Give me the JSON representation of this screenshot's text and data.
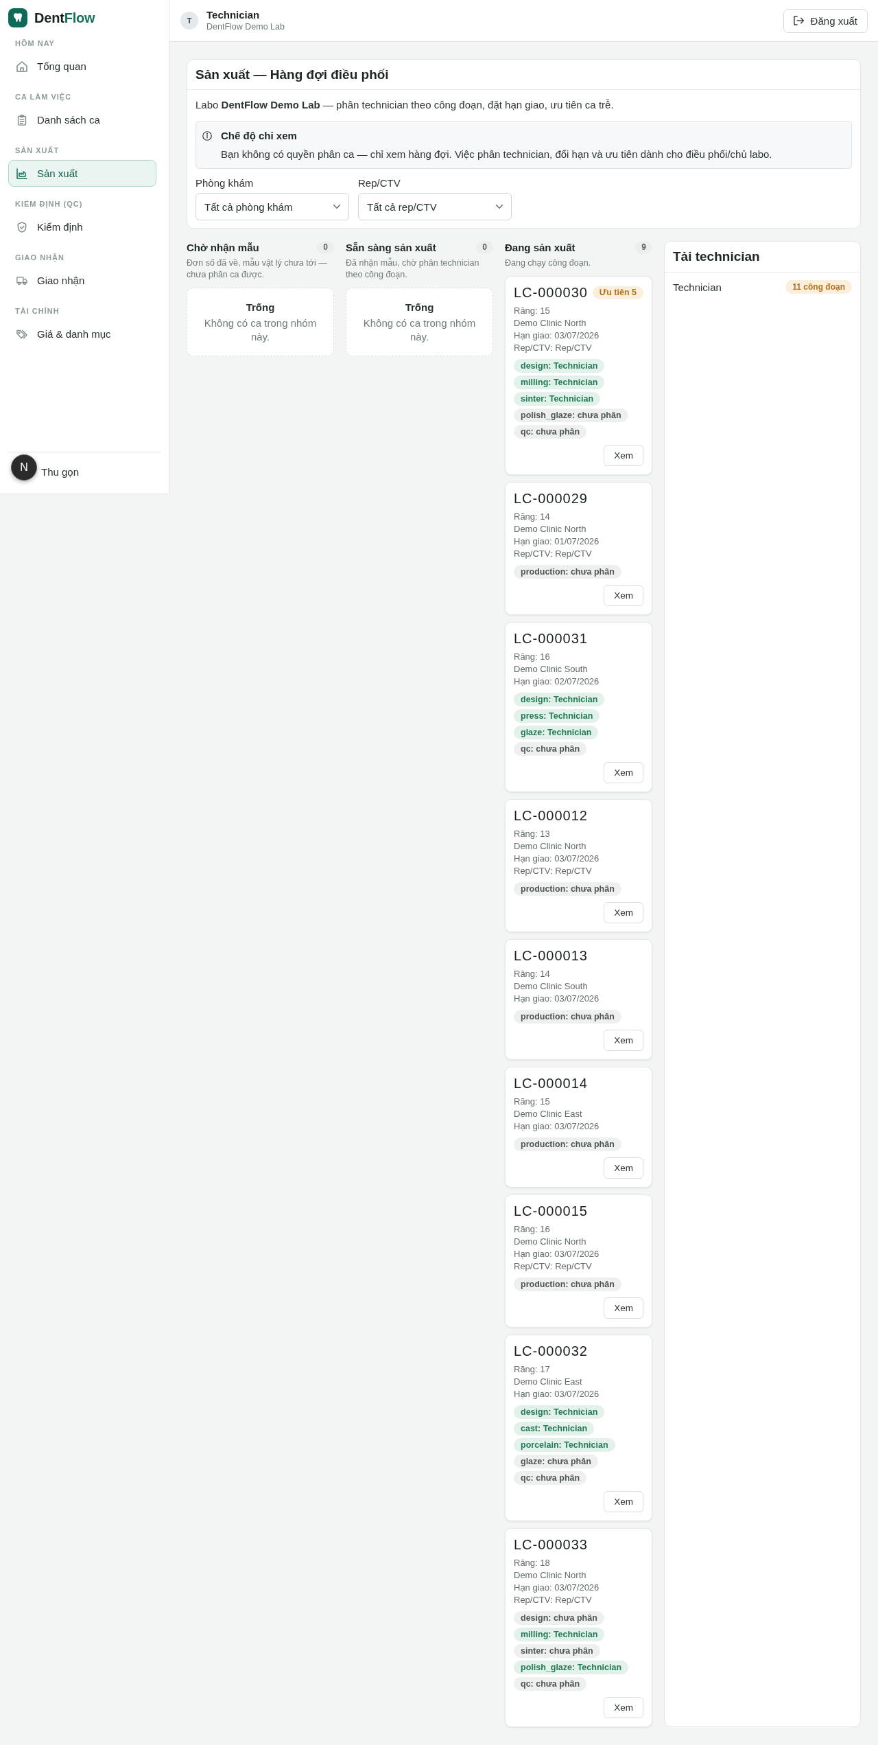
{
  "sidebar": {
    "brand": {
      "lead": "Dent",
      "accent": "Flow"
    },
    "sections": [
      {
        "heading": "HÔM NAY",
        "items": [
          {
            "label": "Tổng quan",
            "selected": false
          }
        ]
      },
      {
        "heading": "CA LÀM VIỆC",
        "items": [
          {
            "label": "Danh sách ca",
            "selected": false
          }
        ]
      },
      {
        "heading": "SẢN XUẤT",
        "items": [
          {
            "label": "Sản xuất",
            "selected": true
          }
        ]
      },
      {
        "heading": "KIỂM ĐỊNH (QC)",
        "items": [
          {
            "label": "Kiểm định",
            "selected": false
          }
        ]
      },
      {
        "heading": "GIAO NHẬN",
        "items": [
          {
            "label": "Giao nhận",
            "selected": false
          }
        ]
      },
      {
        "heading": "TÀI CHÍNH",
        "items": [
          {
            "label": "Giá & danh mục",
            "selected": false
          }
        ]
      }
    ],
    "collapse_label": "Thu gọn"
  },
  "dev_tools_badge": "N",
  "header": {
    "avatar": "T",
    "user_name": "Technician",
    "lab_name": "DentFlow Demo Lab",
    "logout_label": "Đăng xuất"
  },
  "queue_panel": {
    "title": "Sản xuất — Hàng đợi điều phối",
    "description": "Labo **DentFlow Demo Lab** — phân technician theo công đoạn, đặt hạn giao, ưu tiên ca trễ.",
    "notice": {
      "title": "Chế độ chỉ xem",
      "text": "Bạn không có quyền phân ca — chỉ xem hàng đợi. Việc phân technician, đổi hạn và ưu tiên dành cho điều phối/chủ labo."
    },
    "filters": [
      {
        "label": "Phòng khám",
        "value": "Tất cả phòng khám"
      },
      {
        "label": "Rep/CTV",
        "value": "Tất cả rep/CTV"
      }
    ]
  },
  "columns": [
    {
      "title": "Chờ nhận mẫu",
      "count": "0",
      "description": "Đơn số đã về, mẫu vật lý chưa tới — chưa phân ca được.",
      "empty_state": {
        "title": "Trống",
        "text": "Không có ca trong nhóm này."
      }
    },
    {
      "title": "Sẵn sàng sản xuất",
      "count": "0",
      "description": "Đã nhận mẫu, chờ phân technician theo công đoạn.",
      "empty_state": {
        "title": "Trống",
        "text": "Không có ca trong nhóm này."
      }
    },
    {
      "title": "Đang sản xuất",
      "count": "9",
      "description": "Đang chạy công đoạn.",
      "cards": [
        {
          "case_id": "LC-000030",
          "priority": "Ưu tiên 5",
          "teeth": "Răng: 15",
          "clinic": "Demo Clinic North",
          "due": "Hạn giao: 03/07/2026",
          "rep": "Rep/CTV: Rep/CTV",
          "tags": [
            {
              "label": "design: Technician",
              "assigned": true
            },
            {
              "label": "milling: Technician",
              "assigned": true
            },
            {
              "label": "sinter: Technician",
              "assigned": true
            },
            {
              "label": "polish_glaze: chưa phân",
              "assigned": false
            },
            {
              "label": "qc: chưa phân",
              "assigned": false
            }
          ],
          "view_label": "Xem"
        },
        {
          "case_id": "LC-000029",
          "teeth": "Răng: 14",
          "clinic": "Demo Clinic North",
          "due": "Hạn giao: 01/07/2026",
          "rep": "Rep/CTV: Rep/CTV",
          "tags": [
            {
              "label": "production: chưa phân",
              "assigned": false
            }
          ],
          "view_label": "Xem"
        },
        {
          "case_id": "LC-000031",
          "teeth": "Răng: 16",
          "clinic": "Demo Clinic South",
          "due": "Hạn giao: 02/07/2026",
          "tags": [
            {
              "label": "design: Technician",
              "assigned": true
            },
            {
              "label": "press: Technician",
              "assigned": true
            },
            {
              "label": "glaze: Technician",
              "assigned": true
            },
            {
              "label": "qc: chưa phân",
              "assigned": false
            }
          ],
          "view_label": "Xem"
        },
        {
          "case_id": "LC-000012",
          "teeth": "Răng: 13",
          "clinic": "Demo Clinic North",
          "due": "Hạn giao: 03/07/2026",
          "rep": "Rep/CTV: Rep/CTV",
          "tags": [
            {
              "label": "production: chưa phân",
              "assigned": false
            }
          ],
          "view_label": "Xem"
        },
        {
          "case_id": "LC-000013",
          "teeth": "Răng: 14",
          "clinic": "Demo Clinic South",
          "due": "Hạn giao: 03/07/2026",
          "tags": [
            {
              "label": "production: chưa phân",
              "assigned": false
            }
          ],
          "view_label": "Xem"
        },
        {
          "case_id": "LC-000014",
          "teeth": "Răng: 15",
          "clinic": "Demo Clinic East",
          "due": "Hạn giao: 03/07/2026",
          "tags": [
            {
              "label": "production: chưa phân",
              "assigned": false
            }
          ],
          "view_label": "Xem"
        },
        {
          "case_id": "LC-000015",
          "teeth": "Răng: 16",
          "clinic": "Demo Clinic North",
          "due": "Hạn giao: 03/07/2026",
          "rep": "Rep/CTV: Rep/CTV",
          "tags": [
            {
              "label": "production: chưa phân",
              "assigned": false
            }
          ],
          "view_label": "Xem"
        },
        {
          "case_id": "LC-000032",
          "teeth": "Răng: 17",
          "clinic": "Demo Clinic East",
          "due": "Hạn giao: 03/07/2026",
          "tags": [
            {
              "label": "design: Technician",
              "assigned": true
            },
            {
              "label": "cast: Technician",
              "assigned": true
            },
            {
              "label": "porcelain: Technician",
              "assigned": true
            },
            {
              "label": "glaze: chưa phân",
              "assigned": false
            },
            {
              "label": "qc: chưa phân",
              "assigned": false
            }
          ],
          "view_label": "Xem"
        },
        {
          "case_id": "LC-000033",
          "teeth": "Răng: 18",
          "clinic": "Demo Clinic North",
          "due": "Hạn giao: 03/07/2026",
          "rep": "Rep/CTV: Rep/CTV",
          "tags": [
            {
              "label": "design: chưa phân",
              "assigned": false
            },
            {
              "label": "milling: Technician",
              "assigned": true
            },
            {
              "label": "sinter: chưa phân",
              "assigned": false
            },
            {
              "label": "polish_glaze: Technician",
              "assigned": true
            },
            {
              "label": "qc: chưa phân",
              "assigned": false
            }
          ],
          "view_label": "Xem"
        }
      ]
    }
  ],
  "technician_load": {
    "title": "Tải technician",
    "rows": [
      {
        "name": "Technician",
        "load": "11 công đoạn"
      }
    ]
  }
}
